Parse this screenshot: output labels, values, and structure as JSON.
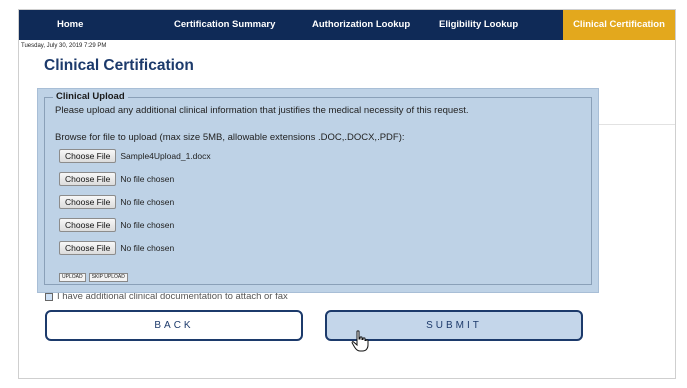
{
  "nav": {
    "home": "Home",
    "certification_summary": "Certification Summary",
    "authorization_lookup": "Authorization Lookup",
    "eligibility_lookup": "Eligibility Lookup",
    "clinical_certification": "Clinical Certification"
  },
  "datestamp": "Tuesday, July 30, 2019 7:29 PM",
  "page_title": "Clinical Certification",
  "upload": {
    "legend": "Clinical Upload",
    "instructions": "Please upload any additional clinical information that justifies the medical necessity of this request.",
    "browse_label": "Browse for file to upload (max size 5MB, allowable extensions .DOC,.DOCX,.PDF):",
    "choose_file_label": "Choose File",
    "files": [
      "Sample4Upload_1.docx",
      "No file chosen",
      "No file chosen",
      "No file chosen",
      "No file chosen"
    ],
    "upload_button": "UPLOAD",
    "skip_upload_button": "SKIP UPLOAD"
  },
  "additional_docs_label": "I have additional clinical documentation to attach or fax",
  "buttons": {
    "back": "BACK",
    "submit": "SUBMIT"
  },
  "colors": {
    "nav_bg": "#0f2a57",
    "nav_active": "#e3a81d",
    "panel_bg": "#bed2e6",
    "title": "#1c3a6b"
  },
  "icons": {
    "cursor": "hand-pointer-icon"
  }
}
